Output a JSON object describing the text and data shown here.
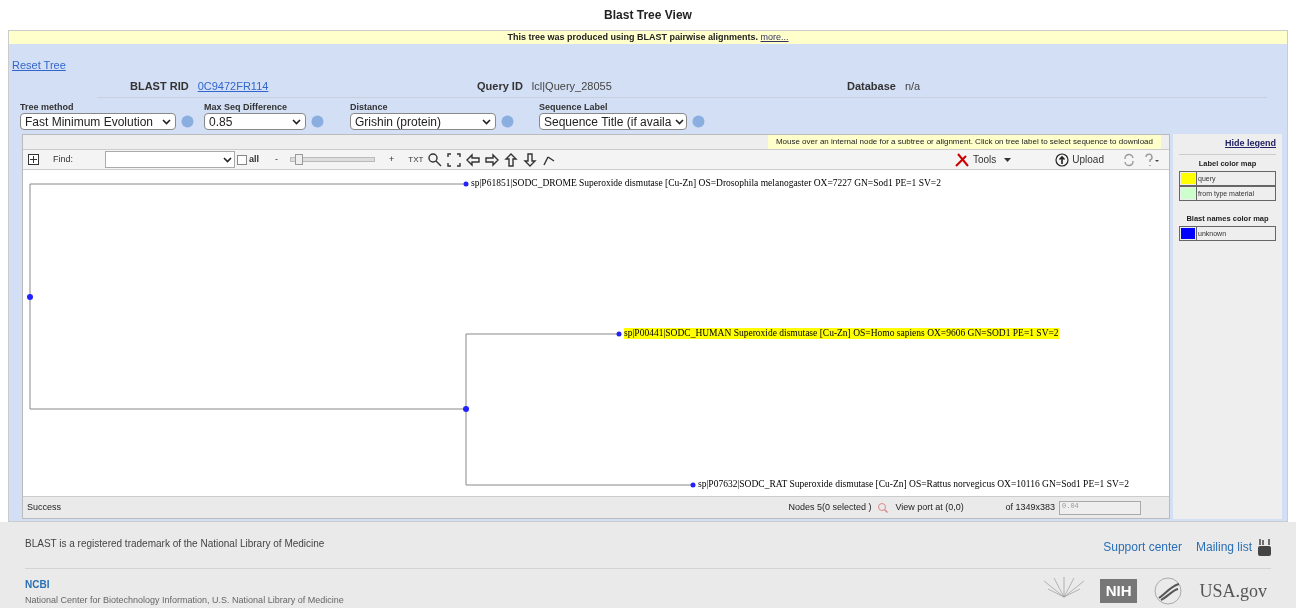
{
  "title": "Blast Tree View",
  "banner": {
    "text": "This tree was produced using BLAST pairwise alignments.",
    "link": "more..."
  },
  "reset_link": "Reset Tree",
  "info": [
    {
      "label": "BLAST RID",
      "value": "0C9472FR114",
      "kind": "link"
    },
    {
      "label": "Query ID",
      "value": "lcl|Query_28055",
      "kind": "text"
    },
    {
      "label": "Database",
      "value": "n/a",
      "kind": "text"
    }
  ],
  "options": [
    {
      "label": "Tree method",
      "value": "Fast Minimum Evolution"
    },
    {
      "label": "Max Seq Difference",
      "value": "0.85"
    },
    {
      "label": "Distance",
      "value": "Grishin (protein)"
    },
    {
      "label": "Sequence Label",
      "value": "Sequence Title (if availa"
    }
  ],
  "hint": "Mouse over an internal node for a subtree or alignment. Click on tree label to select sequence to download",
  "toolbar": {
    "find_label": "Find:",
    "all_label": "all",
    "all_checked": false,
    "zoom_out": "-",
    "zoom_in": "+",
    "zoom_slider": {
      "level": 0.05
    },
    "txt": "TXT",
    "tools": "Tools",
    "upload": "Upload"
  },
  "tree": {
    "children": [
      {
        "label": "sp|P61851|SODC_DROME Superoxide dismutase [Cu-Zn] OS=Drosophila melanogaster OX=7227 GN=Sod1 PE=1 SV=2",
        "highlighted": false
      },
      {
        "children": [
          {
            "label": "sp|P00441|SODC_HUMAN Superoxide dismutase [Cu-Zn] OS=Homo sapiens OX=9606 GN=SOD1 PE=1 SV=2",
            "highlighted": true
          },
          {
            "label": "sp|P07632|SODC_RAT Superoxide dismutase [Cu-Zn] OS=Rattus norvegicus OX=10116 GN=Sod1 PE=1 SV=2",
            "highlighted": false
          }
        ]
      }
    ]
  },
  "legend": {
    "hide_link": "Hide legend",
    "maps": [
      {
        "title": "Label color map",
        "items": [
          {
            "name": "query",
            "color": "#ffff00"
          },
          {
            "name": "from type material",
            "color": "#ccffcc"
          }
        ]
      },
      {
        "title": "Blast names color map",
        "items": [
          {
            "name": "unknown",
            "color": "#0000ff"
          }
        ]
      }
    ]
  },
  "status": {
    "text": "Success",
    "nodes": "Nodes 5(0 selected )",
    "viewport": "View port at (0,0)",
    "size": "of 1349x383",
    "scale": "0.04"
  },
  "footer": {
    "trademark": "BLAST is a registered trademark of the National Library of Medicine",
    "links": [
      "Support center",
      "Mailing list"
    ],
    "org": "NCBI",
    "org_sub": "National Center for Biotechnology Information, U.S. National Library of Medicine",
    "logos": [
      "NIH",
      "USA.gov"
    ]
  }
}
